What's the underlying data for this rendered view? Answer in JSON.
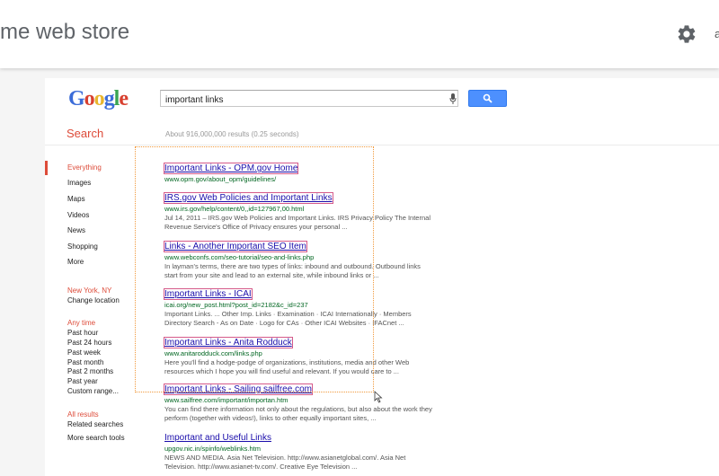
{
  "header": {
    "title": "me web store",
    "edge_char": "a"
  },
  "google": {
    "logo_text": "Google",
    "query": "important links",
    "search_label": "Search",
    "stats": "About 916,000,000 results (0.25 seconds)"
  },
  "leftnav": {
    "items": [
      "Everything",
      "Images",
      "Maps",
      "Videos",
      "News",
      "Shopping",
      "More"
    ],
    "location": "New York, NY",
    "change_location": "Change location",
    "time_header": "Any time",
    "time_items": [
      "Past hour",
      "Past 24 hours",
      "Past week",
      "Past month",
      "Past 2 months",
      "Past year",
      "Custom range..."
    ],
    "results_header": "All results",
    "results_items": [
      "Related searches"
    ],
    "more_tools": "More search tools"
  },
  "results": [
    {
      "title": "Important Links - OPM.gov Home",
      "url": "www.opm.gov/about_opm/guidelines/",
      "snippet": ""
    },
    {
      "title": "IRS.gov Web Policies and Important Links",
      "url": "www.irs.gov/help/content/0,,id=127967,00.html",
      "snippet": "Jul 14, 2011 – IRS.gov Web Policies and Important Links. IRS Privacy Policy The Internal Revenue Service's Office of Privacy ensures your personal ..."
    },
    {
      "title": "Links - Another Important SEO Item",
      "url": "www.webconfs.com/seo-tutorial/seo-and-links.php",
      "snippet": "In layman's terms, there are two types of links: inbound and outbound. Outbound links start from your site and lead to an external site, while inbound links or ..."
    },
    {
      "title": "Important Links - ICAI",
      "url": "icai.org/new_post.html?post_id=2182&c_id=237",
      "snippet": "Important Links. ... Other Imp. Links · Examination · ICAI Internationally · Members Directory Search - As on Date · Logo for CAs · Other ICAI Websites · IFACnet ..."
    },
    {
      "title": "Important Links - Anita Rodduck",
      "url": "www.anitarodduck.com/links.php",
      "snippet": "Here you'll find a hodge-podge of organizations, institutions, media and other Web resources which I hope you will find useful and relevant. If you would care to ..."
    },
    {
      "title": "Important Links - Sailing sailfree.com",
      "url": "www.sailfree.com/important/importan.htm",
      "snippet": "You can find there information not only about the regulations, but also about the work they perform (together with videos!), links to other equally important sites, ..."
    },
    {
      "title": "Important and Useful Links",
      "url": "upgov.nic.in/spinfo/weblinks.htm",
      "snippet": "NEWS AND MEDIA. Asia Net Television. http://www.asianetglobal.com/. Asia Net Television. http://www.asianet-tv.com/. Creative Eye Television ..."
    }
  ]
}
